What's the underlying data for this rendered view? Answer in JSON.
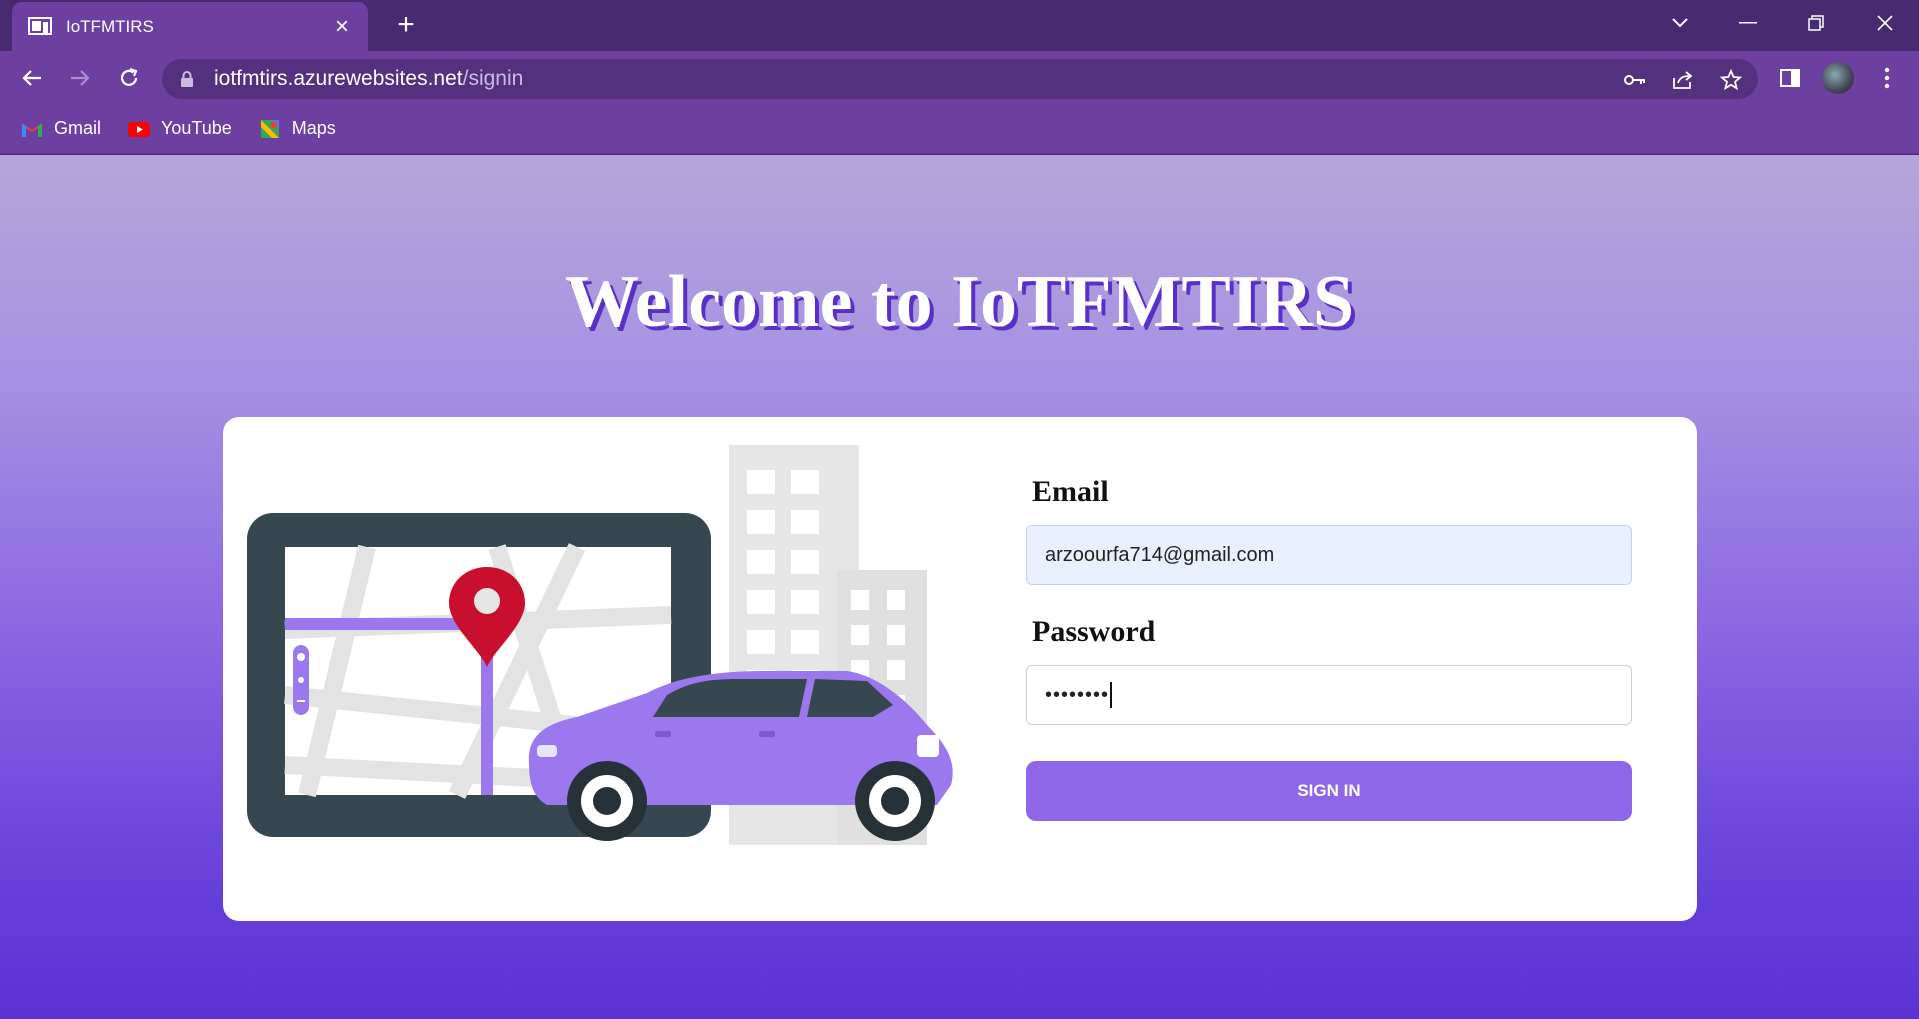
{
  "browser": {
    "tab_title": "IoTFMTIRS",
    "url_domain": "iotfmtirs.azurewebsites.net",
    "url_path": "/signin",
    "bookmarks": [
      {
        "label": "Gmail",
        "icon": "gmail-icon"
      },
      {
        "label": "YouTube",
        "icon": "youtube-icon"
      },
      {
        "label": "Maps",
        "icon": "maps-icon"
      }
    ]
  },
  "page": {
    "heading": "Welcome to IoTFMTIRS",
    "email_label": "Email",
    "email_value": "arzoourfa714@gmail.com",
    "password_label": "Password",
    "password_masked": "••••••••",
    "signin_label": "SIGN IN"
  },
  "colors": {
    "accent": "#9066e8",
    "chrome": "#6c3fa0",
    "car": "#9b78ee",
    "pin": "#c8102e"
  }
}
